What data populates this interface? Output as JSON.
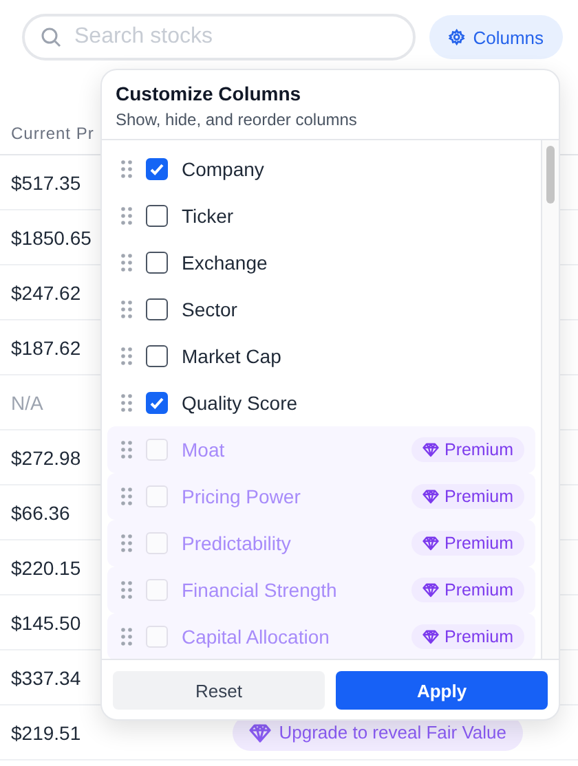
{
  "search": {
    "placeholder": "Search stocks"
  },
  "columns_button": {
    "label": "Columns"
  },
  "table": {
    "header": "Current Pr",
    "rows": [
      {
        "price": "$517.35",
        "available": true
      },
      {
        "price": "$1850.65",
        "available": true
      },
      {
        "price": "$247.62",
        "available": true
      },
      {
        "price": "$187.62",
        "available": true
      },
      {
        "price": "N/A",
        "available": false
      },
      {
        "price": "$272.98",
        "available": true
      },
      {
        "price": "$66.36",
        "available": true
      },
      {
        "price": "$220.15",
        "available": true
      },
      {
        "price": "$145.50",
        "available": true
      },
      {
        "price": "$337.34",
        "available": true
      },
      {
        "price": "$219.51",
        "available": true,
        "upgrade": "Upgrade to reveal Fair Value"
      }
    ]
  },
  "popover": {
    "title": "Customize Columns",
    "subtitle": "Show, hide, and reorder columns",
    "items": [
      {
        "label": "Company",
        "kind": "standard",
        "checked": true
      },
      {
        "label": "Ticker",
        "kind": "standard",
        "checked": false
      },
      {
        "label": "Exchange",
        "kind": "standard",
        "checked": false
      },
      {
        "label": "Sector",
        "kind": "standard",
        "checked": false
      },
      {
        "label": "Market Cap",
        "kind": "standard",
        "checked": false
      },
      {
        "label": "Quality Score",
        "kind": "standard",
        "checked": true
      },
      {
        "label": "Moat",
        "kind": "premium",
        "checked": false,
        "badge": "Premium"
      },
      {
        "label": "Pricing Power",
        "kind": "premium",
        "checked": false,
        "badge": "Premium"
      },
      {
        "label": "Predictability",
        "kind": "premium",
        "checked": false,
        "badge": "Premium"
      },
      {
        "label": "Financial Strength",
        "kind": "premium",
        "checked": false,
        "badge": "Premium"
      },
      {
        "label": "Capital Allocation",
        "kind": "premium",
        "checked": false,
        "badge": "Premium"
      }
    ],
    "buttons": [
      {
        "label": "Reset",
        "kind": "secondary"
      },
      {
        "label": "Apply",
        "kind": "primary"
      }
    ]
  }
}
